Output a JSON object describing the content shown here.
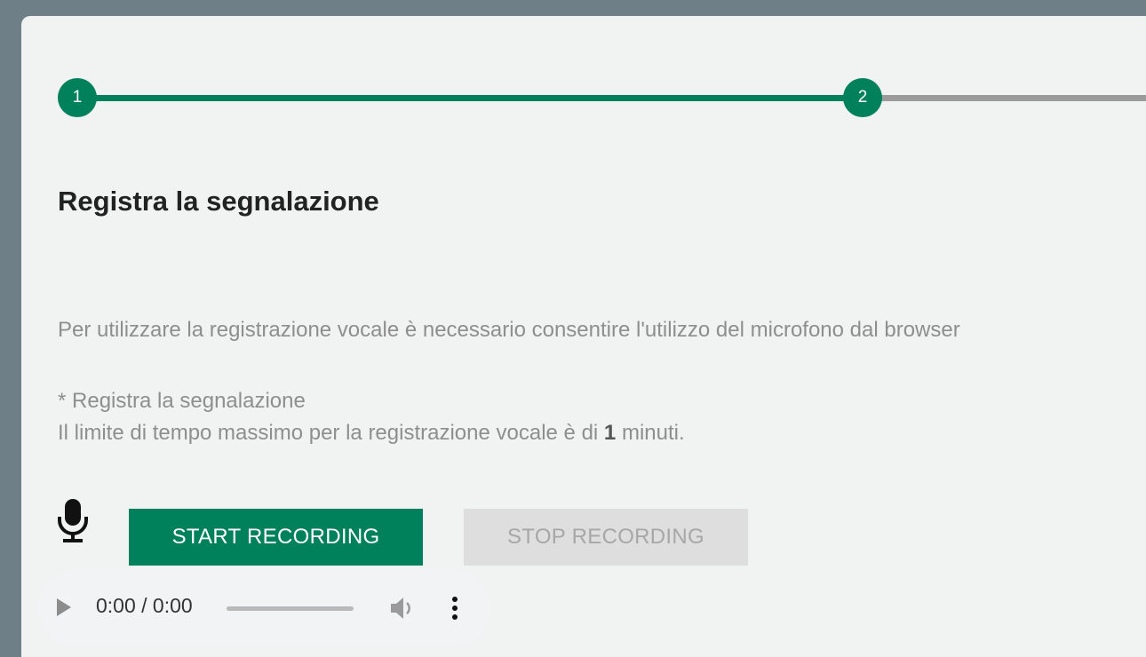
{
  "stepper": {
    "steps": [
      {
        "number": "1",
        "status": "done"
      },
      {
        "number": "2",
        "status": "active"
      }
    ]
  },
  "page": {
    "title": "Registra la segnalazione",
    "info": "Per utilizzare la registrazione vocale è necessario consentire l'utilizzo del microfono dal browser",
    "required_label": "* Registra la segnalazione",
    "limit_prefix": "Il limite di tempo massimo per la registrazione vocale è di",
    "limit_value": "1",
    "limit_suffix": "minuti."
  },
  "controls": {
    "mic_icon": "microphone-icon",
    "start_label": "START RECORDING",
    "stop_label": "STOP RECORDING"
  },
  "player": {
    "time": "0:00 / 0:00",
    "progress": 0
  },
  "colors": {
    "accent": "#00815c",
    "inactive_line": "#9a9a9a",
    "disabled_button": "#dedede"
  }
}
